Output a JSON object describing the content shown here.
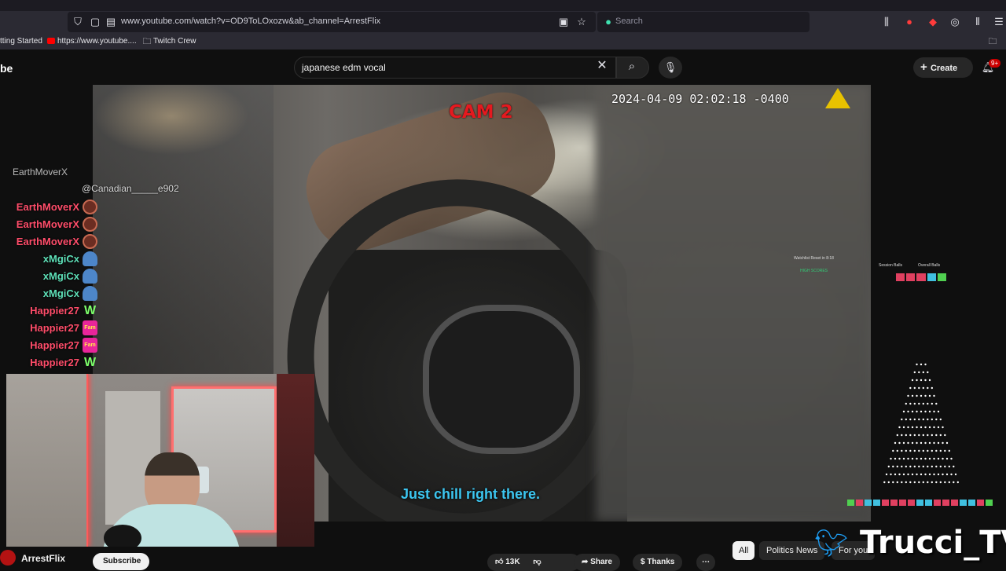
{
  "browser": {
    "url": "www.youtube.com/watch?v=OD9ToLOxozw&ab_channel=ArrestFlix",
    "search_placeholder": "Search",
    "bookmarks": [
      "tting Started",
      "https://www.youtube....",
      "Twitch Crew"
    ]
  },
  "youtube": {
    "logo": "be",
    "search_query": "japanese edm vocal",
    "create_label": "Create",
    "notifications_badge": "9+"
  },
  "video": {
    "cam_label": "CAM 2",
    "timestamp": "2024-04-09 02:02:18 -0400",
    "subtitle": "Just chill right there.",
    "stats": {
      "main_label": "Watchlist Reset in",
      "main_time": "8:18",
      "session_balls": "Session Balls",
      "overall_balls": "Overall Balls",
      "high_scores": "HIGH SCORES"
    }
  },
  "chat": {
    "faded_top": "EarthMoverX",
    "mention": "@Canadian_____e902",
    "lines": [
      {
        "name": "EarthMoverX",
        "color": "#ff4d6a",
        "emote": "circle"
      },
      {
        "name": "EarthMoverX",
        "color": "#ff4d6a",
        "emote": "circle"
      },
      {
        "name": "EarthMoverX",
        "color": "#ff4d6a",
        "emote": "circle"
      },
      {
        "name": "xMgiCx",
        "color": "#5ee0b8",
        "emote": "ghost"
      },
      {
        "name": "xMgiCx",
        "color": "#5ee0b8",
        "emote": "ghost"
      },
      {
        "name": "xMgiCx",
        "color": "#5ee0b8",
        "emote": "ghost"
      },
      {
        "name": "Happier27",
        "color": "#ff4d6a",
        "emote": "W"
      },
      {
        "name": "Happier27",
        "color": "#ff4d6a",
        "emote": "Fam"
      },
      {
        "name": "Happier27",
        "color": "#ff4d6a",
        "emote": "Fam"
      },
      {
        "name": "Happier27",
        "color": "#ff4d6a",
        "emote": "W"
      }
    ]
  },
  "bottom": {
    "channel_name": "ArrestFlix",
    "subscribe": "Subscribe",
    "likes": "13K",
    "share": "Share",
    "thanks": "Thanks",
    "chips": [
      "All",
      "Politics News",
      "For you"
    ],
    "watermark": "Trucci_TV"
  },
  "colors": {
    "yt_red": "#cc0000",
    "subtitle_blue": "#3cc6f0",
    "cam_red": "#e5191f"
  }
}
